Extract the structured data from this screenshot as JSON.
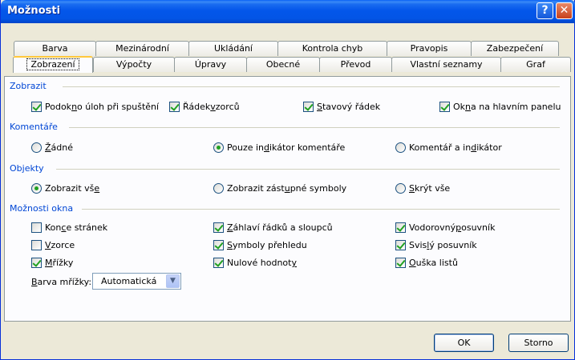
{
  "window": {
    "title": "Možnosti",
    "help_glyph": "?",
    "close_glyph": "✕"
  },
  "tabs_row1": [
    "Barva",
    "Mezinárodní",
    "Ukládání",
    "Kontrola chyb",
    "Pravopis",
    "Zabezpečení"
  ],
  "tabs_row2": [
    "Zobrazení",
    "Výpočty",
    "Úpravy",
    "Obecné",
    "Převod",
    "Vlastní seznamy",
    "Graf"
  ],
  "active_tab": "Zobrazení",
  "groups": {
    "zobrazit": "Zobrazit",
    "komentare": "Komentáře",
    "objekty": "Objekty",
    "moznosti_okna": "Možnosti okna"
  },
  "zobrazit": {
    "podokno": {
      "pre": "Podok",
      "u": "n",
      "post": "o úloh při spuštění",
      "checked": true
    },
    "radek": {
      "pre": "Řádek ",
      "u": "v",
      "post": "zorců",
      "checked": true
    },
    "stavovy": {
      "pre": "",
      "u": "S",
      "post": "tavový řádek",
      "checked": true
    },
    "okna": {
      "pre": "Ok",
      "u": "n",
      "post": "a na hlavním panelu",
      "checked": true
    }
  },
  "komentare": {
    "zadne": {
      "pre": "",
      "u": "Ž",
      "post": "ádné",
      "selected": false
    },
    "pouze": {
      "pre": "Pouze in",
      "u": "d",
      "post": "ikátor komentáře",
      "selected": true
    },
    "komentar": {
      "pre": "Komentář a in",
      "u": "d",
      "post": "ikátor",
      "selected": false
    }
  },
  "objekty": {
    "vse": {
      "pre": "Zobrazit vš",
      "u": "e",
      "post": "",
      "selected": true
    },
    "zastupne": {
      "pre": "Zobrazit zást",
      "u": "u",
      "post": "pné symboly",
      "selected": false
    },
    "skryt": {
      "pre": "",
      "u": "S",
      "post": "krýt vše",
      "selected": false
    }
  },
  "okna": {
    "konce": {
      "pre": "Kon",
      "u": "c",
      "post": "e stránek",
      "checked": false
    },
    "vzorce": {
      "pre": "",
      "u": "V",
      "post": "zorce",
      "checked": false
    },
    "mrizky": {
      "pre": "",
      "u": "M",
      "post": "řížky",
      "checked": true
    },
    "zahlavi": {
      "pre": "",
      "u": "Z",
      "post": "áhlaví řádků a sloupců",
      "checked": true
    },
    "symboly": {
      "pre": "",
      "u": "S",
      "post": "ymboly přehledu",
      "checked": true
    },
    "nulove": {
      "pre": "Nulové hodnot",
      "u": "y",
      "post": "",
      "checked": true
    },
    "vodorovny": {
      "pre": "Vodorovný ",
      "u": "p",
      "post": "osuvník",
      "checked": true
    },
    "svisly": {
      "pre": "Svis",
      "u": "l",
      "post": "ý posuvník",
      "checked": true
    },
    "ouska": {
      "pre": "",
      "u": "O",
      "post": "uška listů",
      "checked": true
    }
  },
  "barva_mrizky": {
    "pre": "",
    "u": "B",
    "post": "arva mřížky:",
    "value": "Automatická"
  },
  "buttons": {
    "ok": "OK",
    "cancel": "Storno"
  }
}
